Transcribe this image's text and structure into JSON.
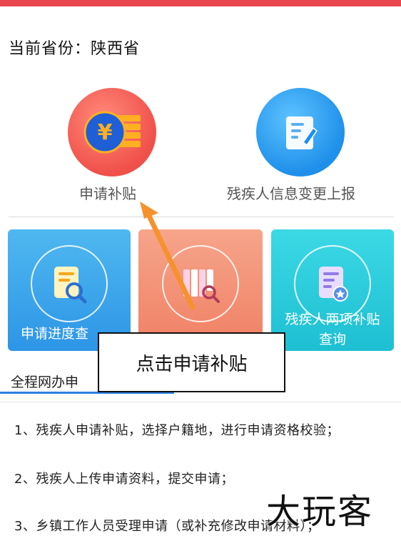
{
  "province": {
    "label": "当前省份：陕西省"
  },
  "services": [
    {
      "label": "申请补贴",
      "icon": "yuan-coin-icon",
      "color": "#f0504a"
    },
    {
      "label": "残疾人信息变更上报",
      "icon": "document-edit-icon",
      "color": "#1e8fea"
    }
  ],
  "cards": [
    {
      "label": "申请进度查",
      "icon": "document-search-icon",
      "color": "#2d95e6"
    },
    {
      "label": "",
      "icon": "books-search-icon",
      "color": "#f07f63"
    },
    {
      "label_line1": "残疾人两项补贴",
      "label_line2": "查询",
      "icon": "document-badge-icon",
      "color": "#1dbfd2"
    }
  ],
  "callout": {
    "text": "点击申请补贴"
  },
  "tab": {
    "label": "全程网办申"
  },
  "steps": [
    "1、残疾人申请补贴，选择户籍地，进行申请资格校验；",
    "2、残疾人上传申请资料，提交申请；",
    "3、乡镇工作人员受理申请（或补充修改申请材料）；"
  ],
  "watermark": {
    "text": "大玩客"
  },
  "colors": {
    "topbar": "#e8474e",
    "arrow": "#f5922e",
    "tab_underline": "#2d7fe0"
  }
}
